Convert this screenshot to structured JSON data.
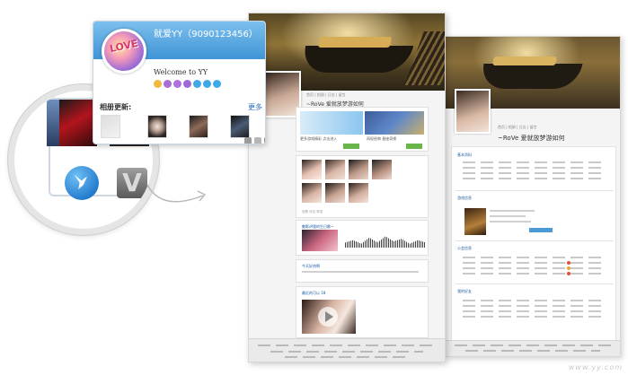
{
  "popup": {
    "title": "就爱YY（9090123456）",
    "welcome": "Welcome to YY",
    "album_label": "相册更新:",
    "more_label": "更多",
    "avatar_text": "LOVE"
  },
  "badges": [
    {
      "icon": "crown-icon",
      "color": "#f0b93a"
    },
    {
      "icon": "level-badge-icon",
      "color": "#a86fd6"
    },
    {
      "icon": "level-badge-icon",
      "color": "#b070e0"
    },
    {
      "icon": "level-badge-icon",
      "color": "#9b6ad6"
    },
    {
      "icon": "diamond-icon",
      "color": "#3fa9e8"
    },
    {
      "icon": "diamond-icon",
      "color": "#3fa9e8"
    },
    {
      "icon": "diamond-icon",
      "color": "#3fa9e8"
    }
  ],
  "magnifier": {
    "v_icon_text": "V"
  },
  "page_front": {
    "name": "~RoVe 爱就放梦游如何",
    "tabs": "首页 | 相册 | 日志 | 留言",
    "ad_text": "更多游戏精彩 点击进入",
    "ad_text2": "再现经典 星座奇缘",
    "photos_title": "",
    "audio_title": "魅影讲我的生日歌~",
    "text_title": "今天好热啊",
    "video_title": "最近的可以 18",
    "meta": "查看 评论 转发"
  },
  "page_back": {
    "name": "~RoVe 爱就放梦游如何",
    "tabs": "首页 | 相册 | 日志 | 留言",
    "section1": "基本资料",
    "section2": "游戏信息",
    "section3": "公会信息",
    "section4": "我的好友"
  },
  "watermark": "www.yy.com"
}
